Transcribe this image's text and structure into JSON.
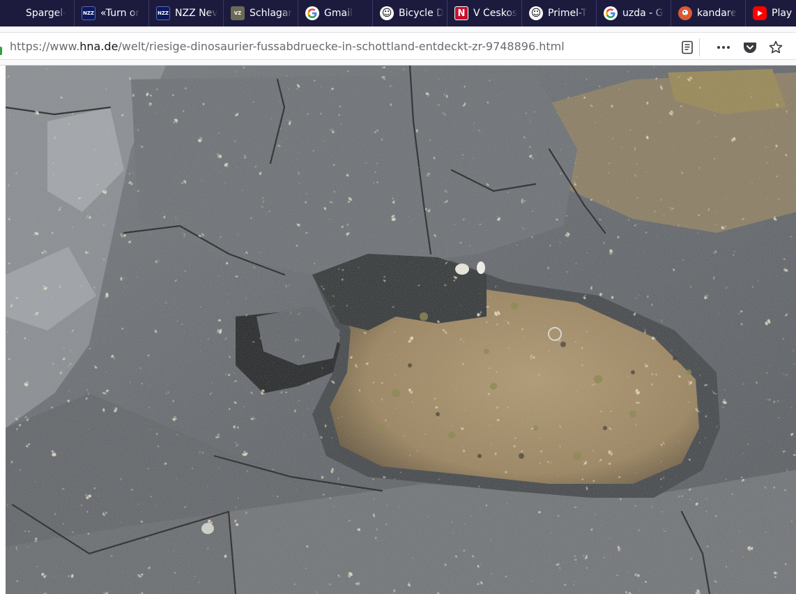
{
  "tabs": [
    {
      "label": "Spargel-",
      "icon": "blank-favicon-icon"
    },
    {
      "label": "«Turn or",
      "icon": "nzz-favicon-icon"
    },
    {
      "label": "NZZ Nev",
      "icon": "nzz-favicon-icon"
    },
    {
      "label": "Schlagar",
      "icon": "vz-favicon-icon"
    },
    {
      "label": "Gmail",
      "icon": "google-favicon-icon"
    },
    {
      "label": "Bicycle D",
      "icon": "smiley-favicon-icon"
    },
    {
      "label": "V Českos",
      "icon": "n-favicon-icon"
    },
    {
      "label": "Primel-T",
      "icon": "smiley-favicon-icon"
    },
    {
      "label": "uzda - G",
      "icon": "google-favicon-icon"
    },
    {
      "label": "kandare",
      "icon": "duckduckgo-favicon-icon"
    },
    {
      "label": "Play H",
      "icon": "youtube-favicon-icon"
    }
  ],
  "tab_icon_text": {
    "nzz": "NZZ",
    "vz": "VZ",
    "n": "N",
    "smile": "☺"
  },
  "address_bar": {
    "url_prefix": "https://www.",
    "url_host": "hna.de",
    "url_path": "/welt/riesige-dinosaurier-fussabdruecke-in-schottland-entdeckt-zr-9748896.html"
  },
  "toolbar": {
    "reader_view": "reader-view-icon",
    "more_actions": "more-actions-icon",
    "pocket": "pocket-icon",
    "bookmark": "bookmark-star-icon"
  },
  "photo": {
    "subject": "dinosaur-footprint-photo",
    "rock_color": "#6e7275",
    "pool_color": "#a58f6a"
  }
}
